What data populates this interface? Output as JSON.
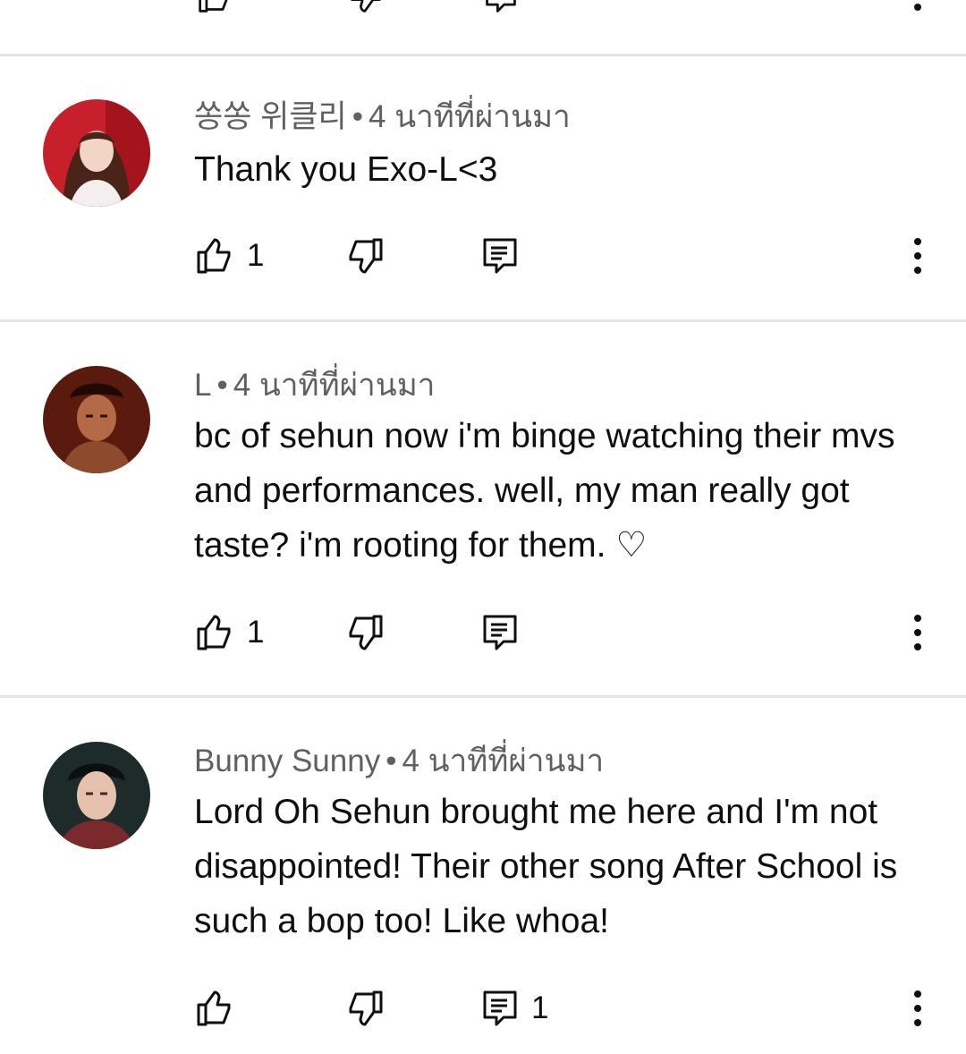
{
  "comments": [
    {
      "author": "쏭쏭 위클리",
      "time": "4 นาทีที่ผ่านมา",
      "text": "Thank you Exo-L<3",
      "likes": "1",
      "replies": "",
      "avatar_colors": [
        "#c8202a",
        "#f1d6c6"
      ]
    },
    {
      "author": "L",
      "time": "4 นาทีที่ผ่านมา",
      "text": "bc of sehun now i'm binge watching their mvs and performances. well, my man really got taste? i'm rooting for them. ♡",
      "likes": "1",
      "replies": "",
      "avatar_colors": [
        "#5a1a0e",
        "#b36a45"
      ]
    },
    {
      "author": "Bunny Sunny",
      "time": "4 นาทีที่ผ่านมา",
      "text": "Lord Oh Sehun brought me here and I'm not disappointed! Their other song After School is such a bop too! Like whoa!",
      "likes": "",
      "replies": "1",
      "avatar_colors": [
        "#1d2c2a",
        "#e6c2ae"
      ]
    }
  ],
  "separator": "•",
  "icons": {
    "like": "thumb-up-icon",
    "dislike": "thumb-down-icon",
    "reply": "reply-icon",
    "more": "more-vertical-icon"
  }
}
